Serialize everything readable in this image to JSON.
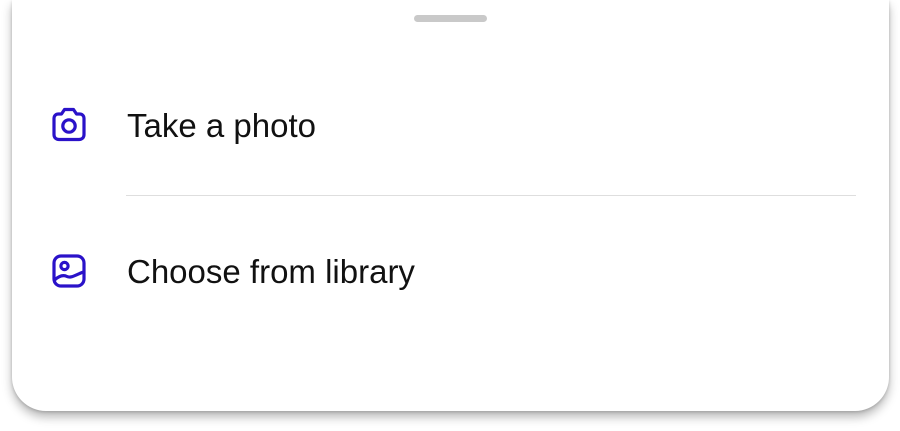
{
  "colors": {
    "icon_accent": "#2a12c9",
    "text": "#111111",
    "divider": "#dedede",
    "grabber": "#c9c9c9"
  },
  "sheet": {
    "options": [
      {
        "label": "Take a photo",
        "icon": "camera-icon"
      },
      {
        "label": "Choose from library",
        "icon": "image-icon"
      }
    ]
  }
}
